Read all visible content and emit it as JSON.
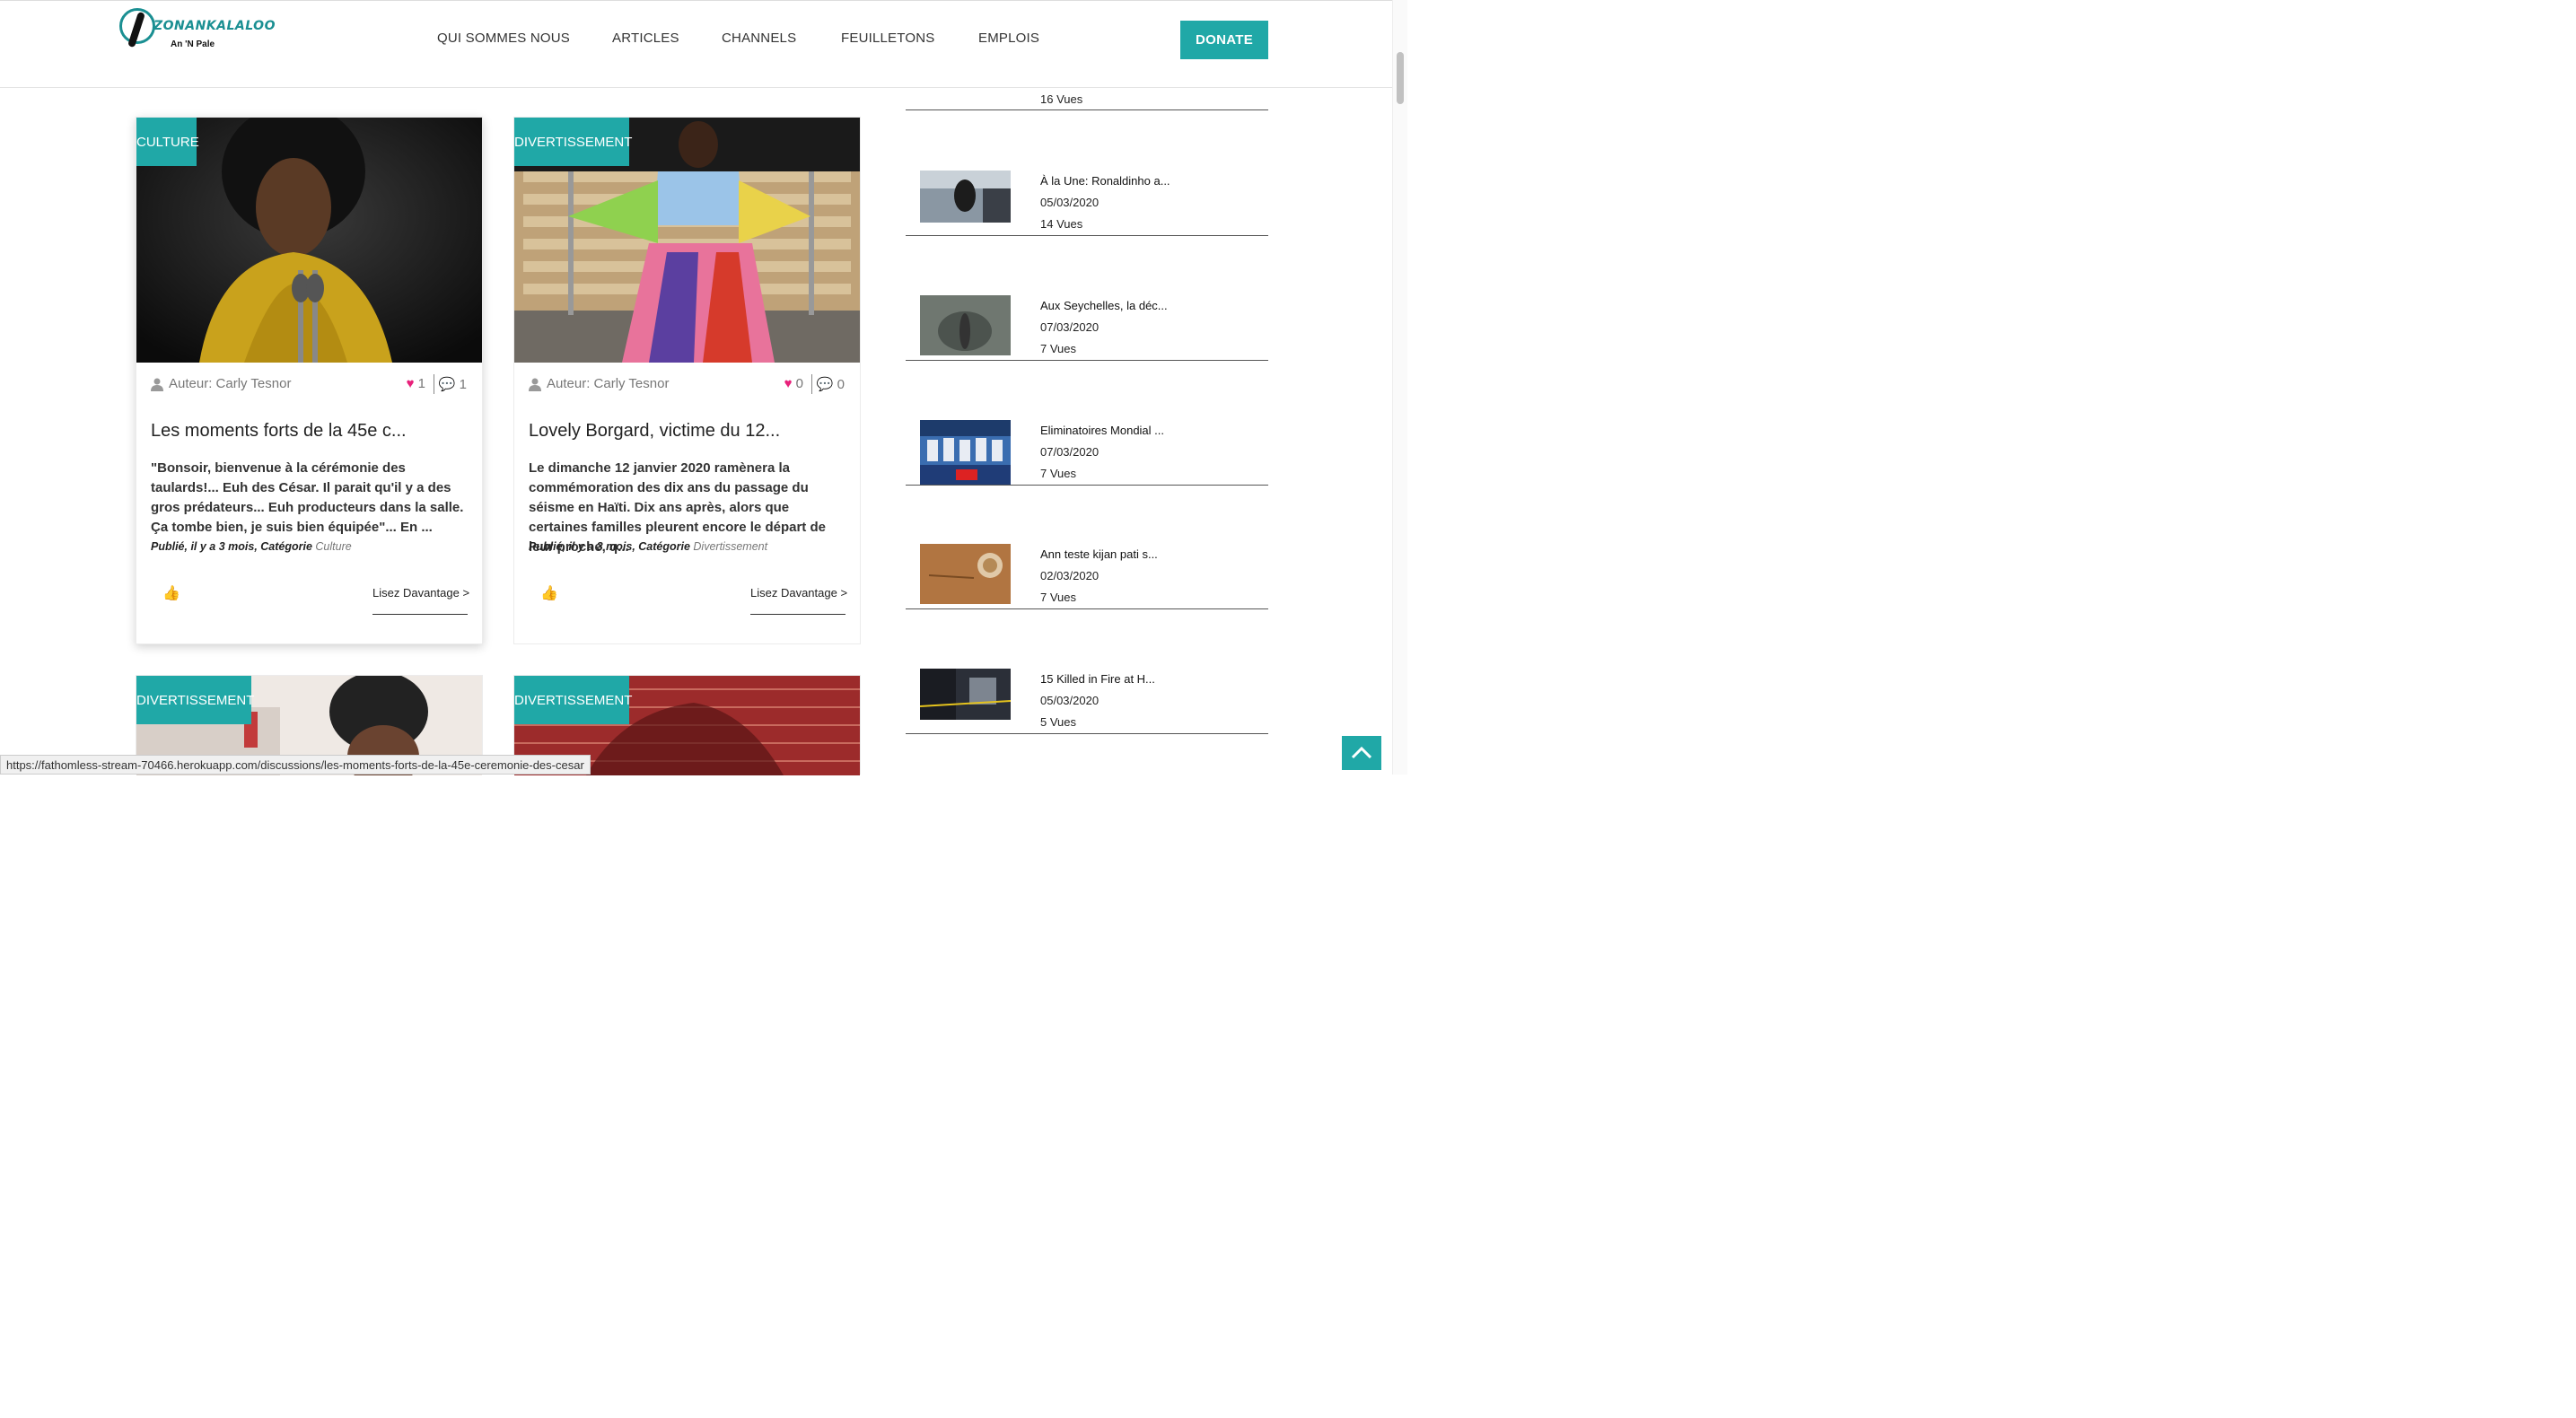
{
  "brand": {
    "logo_text": "ZONANKALALOO",
    "logo_sub": "An 'N Pale"
  },
  "nav": {
    "items": [
      "QUI SOMMES NOUS",
      "ARTICLES",
      "CHANNELS",
      "FEUILLETONS",
      "EMPLOIS"
    ],
    "donate_label": "DONATE"
  },
  "cards": [
    {
      "category": "CULTURE",
      "author": "Auteur: Carly Tesnor",
      "likes": "1",
      "comments": "1",
      "title": "Les moments forts de la 45e c...",
      "excerpt": "\"Bonsoir, bienvenue à la cérémonie des taulards!... Euh des César. Il parait qu'il y a des gros prédateurs... Euh producteurs dans la salle. Ça tombe bien, je suis bien équipée\"... En ...",
      "published": "Publié, il y a 3 mois, Catégorie",
      "published_category": "Culture",
      "read_more": "Lisez Davantage >"
    },
    {
      "category": "DIVERTISSEMENT",
      "author": "Auteur: Carly Tesnor",
      "likes": "0",
      "comments": "0",
      "title": "Lovely Borgard, victime du 12...",
      "excerpt": "Le dimanche 12 janvier 2020 ramènera la commémoration des dix ans du passage du séisme en Haïti. Dix ans après, alors que certaines familles pleurent encore le départ de leur proche, q...",
      "published": "Publié, il y a 3 mois, Catégorie",
      "published_category": "Divertissement",
      "read_more": "Lisez Davantage >"
    },
    {
      "category": "DIVERTISSEMENT"
    },
    {
      "category": "DIVERTISSEMENT"
    }
  ],
  "sidebar": {
    "top_views": "16 Vues",
    "items": [
      {
        "title": "À la Une: Ronaldinho a...",
        "date": "05/03/2020",
        "views": "14 Vues"
      },
      {
        "title": "Aux Seychelles, la déc...",
        "date": "07/03/2020",
        "views": "7 Vues"
      },
      {
        "title": "Eliminatoires Mondial ...",
        "date": "07/03/2020",
        "views": "7 Vues"
      },
      {
        "title": "Ann teste kijan pati s...",
        "date": "02/03/2020",
        "views": "7 Vues"
      },
      {
        "title": "15 Killed in Fire at H...",
        "date": "05/03/2020",
        "views": "5 Vues"
      }
    ]
  },
  "status_url": "https://fathomless-stream-70466.herokuapp.com/discussions/les-moments-forts-de-la-45e-ceremonie-des-cesar",
  "colors": {
    "accent": "#20a8a7",
    "heart": "#e8207a"
  }
}
